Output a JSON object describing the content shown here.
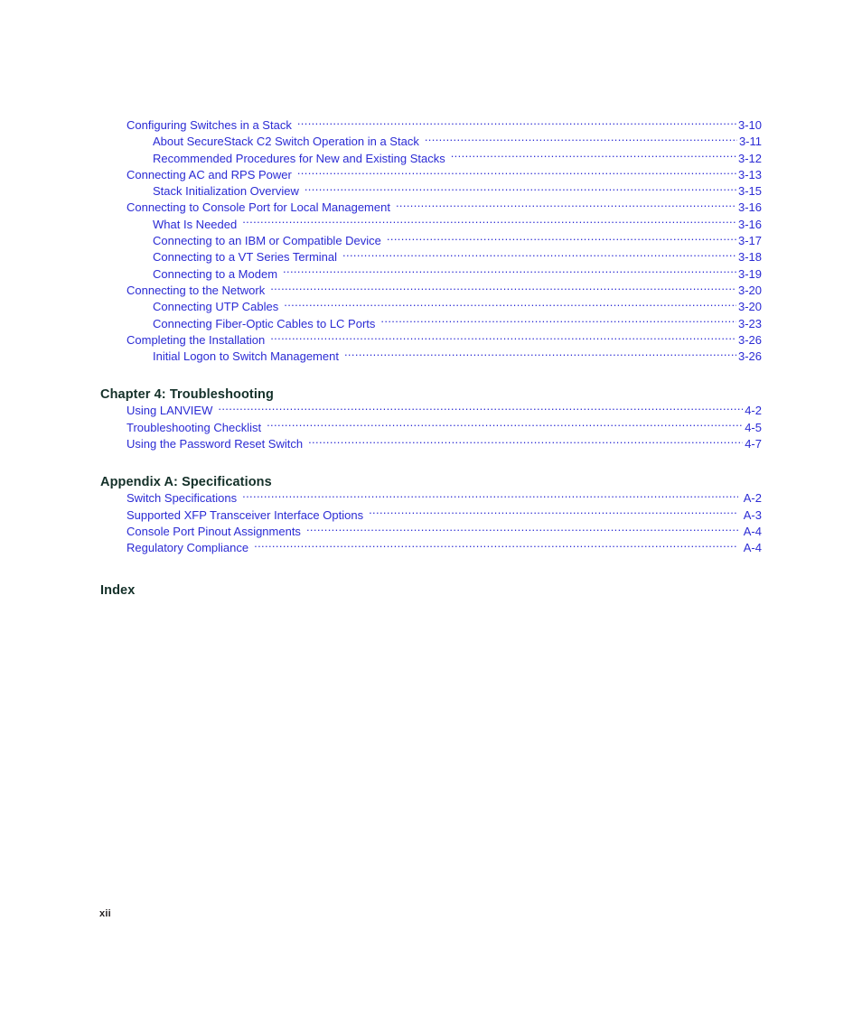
{
  "document": {
    "folio": "xii"
  },
  "colors": {
    "link": "#2b2bd4",
    "heading": "#143029",
    "folio": "#231f20",
    "background": "#ffffff"
  },
  "toc": {
    "groups": [
      {
        "heading": null,
        "entries": [
          {
            "title": "Configuring Switches in a Stack",
            "page": "3-10",
            "level": 1
          },
          {
            "title": "About SecureStack C2 Switch Operation in a Stack",
            "page": "3-11",
            "level": 2
          },
          {
            "title": "Recommended Procedures for New and Existing Stacks",
            "page": "3-12",
            "level": 2
          },
          {
            "title": "Connecting AC and RPS Power",
            "page": "3-13",
            "level": 1
          },
          {
            "title": "Stack Initialization Overview",
            "page": "3-15",
            "level": 2
          },
          {
            "title": "Connecting to Console Port for Local Management",
            "page": "3-16",
            "level": 1
          },
          {
            "title": "What Is Needed",
            "page": "3-16",
            "level": 2
          },
          {
            "title": "Connecting to an IBM or Compatible Device",
            "page": "3-17",
            "level": 2
          },
          {
            "title": "Connecting to a VT Series Terminal",
            "page": "3-18",
            "level": 2
          },
          {
            "title": "Connecting to a Modem",
            "page": "3-19",
            "level": 2
          },
          {
            "title": "Connecting to the Network",
            "page": "3-20",
            "level": 1
          },
          {
            "title": "Connecting UTP Cables",
            "page": "3-20",
            "level": 2
          },
          {
            "title": "Connecting Fiber-Optic Cables to LC Ports",
            "page": "3-23",
            "level": 2
          },
          {
            "title": "Completing the Installation",
            "page": "3-26",
            "level": 1
          },
          {
            "title": "Initial Logon to Switch Management",
            "page": "3-26",
            "level": 2
          }
        ]
      },
      {
        "heading": "Chapter 4: Troubleshooting",
        "entries": [
          {
            "title": "Using LANVIEW",
            "page": "4-2",
            "level": 1
          },
          {
            "title": "Troubleshooting Checklist",
            "page": "4-5",
            "level": 1
          },
          {
            "title": "Using the Password Reset Switch",
            "page": "4-7",
            "level": 1
          }
        ]
      },
      {
        "heading": "Appendix A: Specifications",
        "entries": [
          {
            "title": "Switch Specifications",
            "page": "A-2",
            "level": 1
          },
          {
            "title": "Supported XFP Transceiver Interface Options",
            "page": "A-3",
            "level": 1
          },
          {
            "title": "Console Port Pinout Assignments",
            "page": "A-4",
            "level": 1
          },
          {
            "title": "Regulatory Compliance",
            "page": "A-4",
            "level": 1
          }
        ]
      },
      {
        "heading": "Index",
        "entries": []
      }
    ]
  }
}
